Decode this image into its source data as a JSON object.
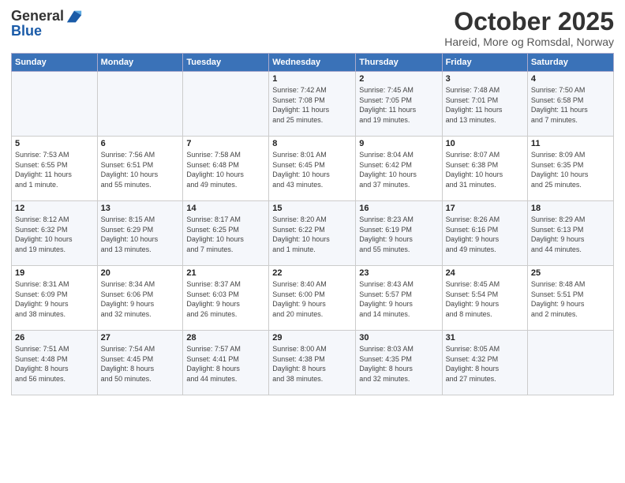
{
  "header": {
    "logo_line1": "General",
    "logo_line2": "Blue",
    "month": "October 2025",
    "location": "Hareid, More og Romsdal, Norway"
  },
  "weekdays": [
    "Sunday",
    "Monday",
    "Tuesday",
    "Wednesday",
    "Thursday",
    "Friday",
    "Saturday"
  ],
  "weeks": [
    [
      {
        "day": "",
        "info": ""
      },
      {
        "day": "",
        "info": ""
      },
      {
        "day": "",
        "info": ""
      },
      {
        "day": "1",
        "info": "Sunrise: 7:42 AM\nSunset: 7:08 PM\nDaylight: 11 hours\nand 25 minutes."
      },
      {
        "day": "2",
        "info": "Sunrise: 7:45 AM\nSunset: 7:05 PM\nDaylight: 11 hours\nand 19 minutes."
      },
      {
        "day": "3",
        "info": "Sunrise: 7:48 AM\nSunset: 7:01 PM\nDaylight: 11 hours\nand 13 minutes."
      },
      {
        "day": "4",
        "info": "Sunrise: 7:50 AM\nSunset: 6:58 PM\nDaylight: 11 hours\nand 7 minutes."
      }
    ],
    [
      {
        "day": "5",
        "info": "Sunrise: 7:53 AM\nSunset: 6:55 PM\nDaylight: 11 hours\nand 1 minute."
      },
      {
        "day": "6",
        "info": "Sunrise: 7:56 AM\nSunset: 6:51 PM\nDaylight: 10 hours\nand 55 minutes."
      },
      {
        "day": "7",
        "info": "Sunrise: 7:58 AM\nSunset: 6:48 PM\nDaylight: 10 hours\nand 49 minutes."
      },
      {
        "day": "8",
        "info": "Sunrise: 8:01 AM\nSunset: 6:45 PM\nDaylight: 10 hours\nand 43 minutes."
      },
      {
        "day": "9",
        "info": "Sunrise: 8:04 AM\nSunset: 6:42 PM\nDaylight: 10 hours\nand 37 minutes."
      },
      {
        "day": "10",
        "info": "Sunrise: 8:07 AM\nSunset: 6:38 PM\nDaylight: 10 hours\nand 31 minutes."
      },
      {
        "day": "11",
        "info": "Sunrise: 8:09 AM\nSunset: 6:35 PM\nDaylight: 10 hours\nand 25 minutes."
      }
    ],
    [
      {
        "day": "12",
        "info": "Sunrise: 8:12 AM\nSunset: 6:32 PM\nDaylight: 10 hours\nand 19 minutes."
      },
      {
        "day": "13",
        "info": "Sunrise: 8:15 AM\nSunset: 6:29 PM\nDaylight: 10 hours\nand 13 minutes."
      },
      {
        "day": "14",
        "info": "Sunrise: 8:17 AM\nSunset: 6:25 PM\nDaylight: 10 hours\nand 7 minutes."
      },
      {
        "day": "15",
        "info": "Sunrise: 8:20 AM\nSunset: 6:22 PM\nDaylight: 10 hours\nand 1 minute."
      },
      {
        "day": "16",
        "info": "Sunrise: 8:23 AM\nSunset: 6:19 PM\nDaylight: 9 hours\nand 55 minutes."
      },
      {
        "day": "17",
        "info": "Sunrise: 8:26 AM\nSunset: 6:16 PM\nDaylight: 9 hours\nand 49 minutes."
      },
      {
        "day": "18",
        "info": "Sunrise: 8:29 AM\nSunset: 6:13 PM\nDaylight: 9 hours\nand 44 minutes."
      }
    ],
    [
      {
        "day": "19",
        "info": "Sunrise: 8:31 AM\nSunset: 6:09 PM\nDaylight: 9 hours\nand 38 minutes."
      },
      {
        "day": "20",
        "info": "Sunrise: 8:34 AM\nSunset: 6:06 PM\nDaylight: 9 hours\nand 32 minutes."
      },
      {
        "day": "21",
        "info": "Sunrise: 8:37 AM\nSunset: 6:03 PM\nDaylight: 9 hours\nand 26 minutes."
      },
      {
        "day": "22",
        "info": "Sunrise: 8:40 AM\nSunset: 6:00 PM\nDaylight: 9 hours\nand 20 minutes."
      },
      {
        "day": "23",
        "info": "Sunrise: 8:43 AM\nSunset: 5:57 PM\nDaylight: 9 hours\nand 14 minutes."
      },
      {
        "day": "24",
        "info": "Sunrise: 8:45 AM\nSunset: 5:54 PM\nDaylight: 9 hours\nand 8 minutes."
      },
      {
        "day": "25",
        "info": "Sunrise: 8:48 AM\nSunset: 5:51 PM\nDaylight: 9 hours\nand 2 minutes."
      }
    ],
    [
      {
        "day": "26",
        "info": "Sunrise: 7:51 AM\nSunset: 4:48 PM\nDaylight: 8 hours\nand 56 minutes."
      },
      {
        "day": "27",
        "info": "Sunrise: 7:54 AM\nSunset: 4:45 PM\nDaylight: 8 hours\nand 50 minutes."
      },
      {
        "day": "28",
        "info": "Sunrise: 7:57 AM\nSunset: 4:41 PM\nDaylight: 8 hours\nand 44 minutes."
      },
      {
        "day": "29",
        "info": "Sunrise: 8:00 AM\nSunset: 4:38 PM\nDaylight: 8 hours\nand 38 minutes."
      },
      {
        "day": "30",
        "info": "Sunrise: 8:03 AM\nSunset: 4:35 PM\nDaylight: 8 hours\nand 32 minutes."
      },
      {
        "day": "31",
        "info": "Sunrise: 8:05 AM\nSunset: 4:32 PM\nDaylight: 8 hours\nand 27 minutes."
      },
      {
        "day": "",
        "info": ""
      }
    ]
  ]
}
